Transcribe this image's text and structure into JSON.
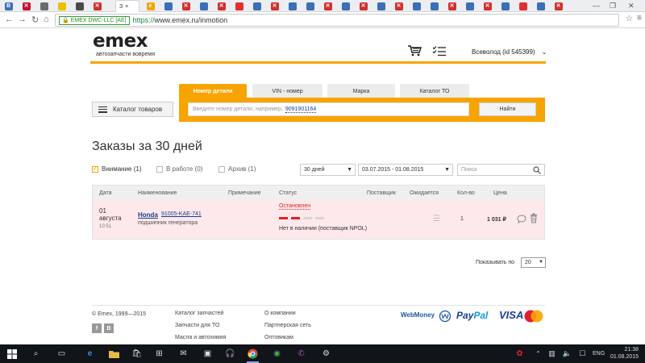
{
  "browser": {
    "active_tab_label": "З",
    "ev_badge": "EMEX DWC-LLC [AE]",
    "url_scheme": "https://",
    "url_rest": "www.emex.ru/inmotion"
  },
  "header": {
    "logo": "emex",
    "tagline": "автозапчасти вовремя",
    "user": "Всеволод (id 545399)"
  },
  "search": {
    "tabs": [
      "Номер детали",
      "VIN - номер",
      "Марка",
      "Каталог ТО"
    ],
    "placeholder": "Введите номер детали, например,",
    "example": "9091901164",
    "find_label": "Найти",
    "catalog_label": "Каталог товаров"
  },
  "page": {
    "title": "Заказы за 30 дней",
    "filters": {
      "attention": "Внимание (1)",
      "in_work": "В работе (0)",
      "archive": "Архив (1)"
    },
    "period": "30 дней",
    "date_range": "03.07.2015 - 01.08.2015",
    "search_placeholder": "Поиск"
  },
  "table": {
    "headers": [
      "Дата",
      "Наименование",
      "Примечание",
      "Статус",
      "Поставщик",
      "Ожидается",
      "Кол-во",
      "Цена"
    ],
    "rows": [
      {
        "date": "01",
        "month": "августа",
        "time": "10:51",
        "brand": "Honda",
        "part_number": "91005-KAE-741",
        "part_name": "подшипник генератора",
        "status": "Остановлен",
        "status_steps": 4,
        "status_active": 2,
        "status_note": "Нет в наличии (поставщик NPOL)",
        "qty": "1",
        "price": "1 031 ₽"
      }
    ]
  },
  "pager": {
    "label": "Показывать по",
    "value": "20"
  },
  "footer": {
    "copyright": "© Emex, 1999—2015",
    "col1": [
      "Каталог запчастей",
      "Запчасти для ТО",
      "Масла и автохимия"
    ],
    "col2": [
      "О компании",
      "Партнерская сеть",
      "Оптовикам"
    ],
    "payments": {
      "webmoney": "WebMoney",
      "paypal_a": "Pay",
      "paypal_b": "Pal",
      "visa": "VISA"
    },
    "social": [
      "f",
      "В"
    ]
  },
  "taskbar": {
    "lang": "ENG",
    "time": "21:38",
    "date": "01.08.2015"
  },
  "colors": {
    "accent": "#f7a400",
    "row_bg": "#fde9eb",
    "status_red": "#e0202a",
    "link": "#1a3d8f"
  }
}
